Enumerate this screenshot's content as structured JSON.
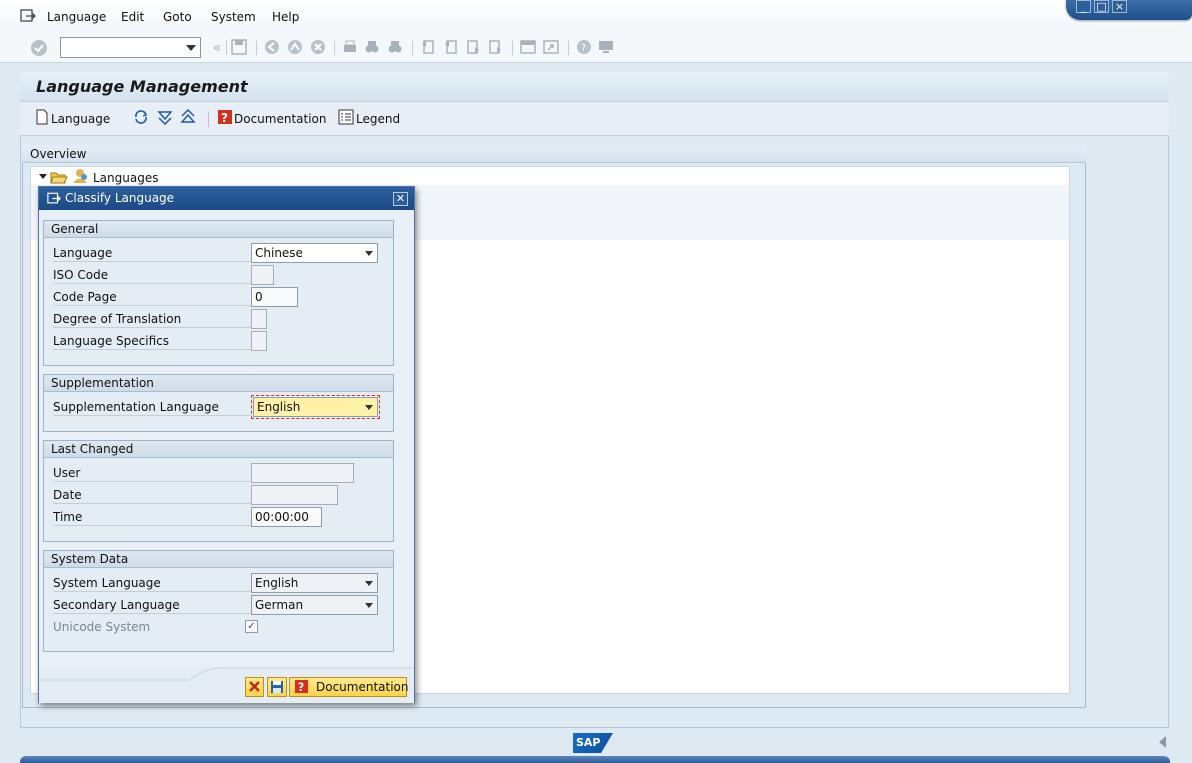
{
  "menubar": {
    "items": [
      "Language",
      "Edit",
      "Goto",
      "System",
      "Help"
    ],
    "mnemonics": [
      "L",
      "E",
      "G",
      "S",
      "H"
    ]
  },
  "toolbar": {
    "command_field_value": ""
  },
  "page": {
    "title": "Language Management"
  },
  "app_toolbar": {
    "language_label": "Language",
    "documentation_label": "Documentation",
    "legend_label": "Legend"
  },
  "overview": {
    "title": "Overview",
    "tree_root": "Languages"
  },
  "dialog": {
    "title": "Classify Language",
    "general": {
      "title": "General",
      "language_label": "Language",
      "language_value": "Chinese",
      "iso_code_label": "ISO Code",
      "iso_code_value": "",
      "code_page_label": "Code Page",
      "code_page_value": "0",
      "degree_label": "Degree of Translation",
      "degree_value": "",
      "specifics_label": "Language Specifics",
      "specifics_value": ""
    },
    "supplementation": {
      "title": "Supplementation",
      "supp_language_label": "Supplementation Language",
      "supp_language_value": "English"
    },
    "last_changed": {
      "title": "Last Changed",
      "user_label": "User",
      "user_value": "",
      "date_label": "Date",
      "date_value": "",
      "time_label": "Time",
      "time_value": "00:00:00"
    },
    "system_data": {
      "title": "System Data",
      "system_language_label": "System Language",
      "system_language_value": "English",
      "secondary_language_label": "Secondary Language",
      "secondary_language_value": "German",
      "unicode_label": "Unicode System",
      "unicode_checked": true
    },
    "footer": {
      "documentation_label": "Documentation"
    }
  },
  "status": {
    "logo_text": "SAP"
  },
  "colors": {
    "titlebar_blue": "#1b4a84",
    "focus_yellow": "#fff2a8",
    "button_yellow": "#f9d44a"
  }
}
